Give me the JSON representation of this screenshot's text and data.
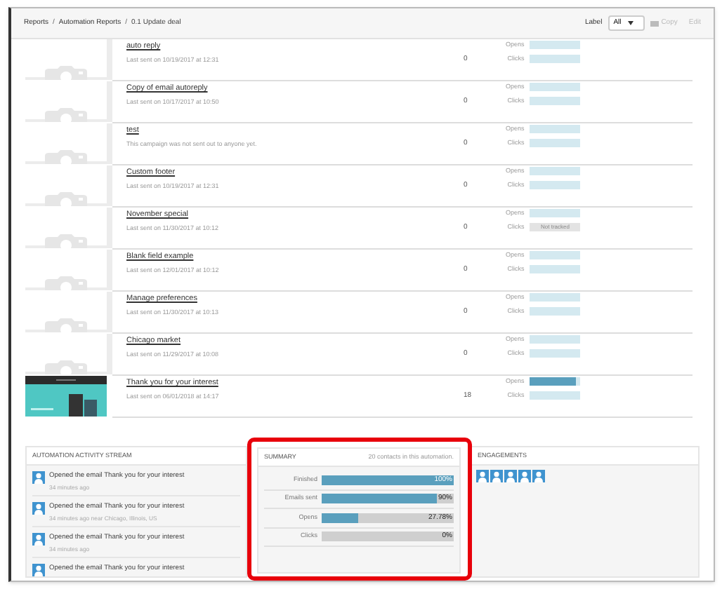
{
  "breadcrumb": [
    {
      "kind": "link",
      "text": "Reports"
    },
    {
      "kind": "separator",
      "text": "/"
    },
    {
      "kind": "link",
      "text": "Automation Reports"
    },
    {
      "kind": "separator",
      "text": "/"
    },
    {
      "kind": "current",
      "text": "0.1 Update deal"
    }
  ],
  "toolbar": {
    "label": "Label",
    "select_value": "All",
    "copy": "Copy",
    "edit": "Edit"
  },
  "emails": [
    {
      "name": "auto reply",
      "meta": "Last sent on 10/19/2017 at 12:31",
      "count": "0",
      "kind": "placeholder",
      "opens": {
        "label": "Opens",
        "level": 0
      },
      "clicks": {
        "label": "Clicks",
        "level": 0
      }
    },
    {
      "name": "Copy of email autoreply",
      "meta": "Last sent on 10/17/2017 at 10:50",
      "count": "0",
      "kind": "placeholder",
      "opens": {
        "label": "Opens",
        "level": 0
      },
      "clicks": {
        "label": "Clicks",
        "level": 0
      }
    },
    {
      "name": "test",
      "meta": "This campaign was not sent out to anyone yet.",
      "count": "0",
      "kind": "placeholder",
      "opens": {
        "label": "Opens",
        "level": 0
      },
      "clicks": {
        "label": "Clicks",
        "level": 0
      }
    },
    {
      "name": "Custom footer",
      "meta": "Last sent on 10/19/2017 at 12:31",
      "count": "0",
      "kind": "placeholder",
      "opens": {
        "label": "Opens",
        "level": 0
      },
      "clicks": {
        "label": "Clicks",
        "level": 0
      }
    },
    {
      "name": "November special",
      "meta": "Last sent on 11/30/2017 at 10:12",
      "count": "0",
      "kind": "placeholder",
      "opens": {
        "label": "Opens",
        "level": 0
      },
      "clicks": {
        "label": "Clicks",
        "note": "Not tracked"
      }
    },
    {
      "name": "Blank field example",
      "meta": "Last sent on 12/01/2017 at 10:12",
      "count": "0",
      "kind": "placeholder",
      "opens": {
        "label": "Opens",
        "level": 0
      },
      "clicks": {
        "label": "Clicks",
        "level": 0
      }
    },
    {
      "name": "Manage preferences",
      "meta": "Last sent on 11/30/2017 at 10:13",
      "count": "0",
      "kind": "placeholder",
      "opens": {
        "label": "Opens",
        "level": 0
      },
      "clicks": {
        "label": "Clicks",
        "level": 0
      }
    },
    {
      "name": "Chicago market",
      "meta": "Last sent on 11/29/2017 at 10:08",
      "count": "0",
      "kind": "placeholder",
      "opens": {
        "label": "Opens",
        "level": 0
      },
      "clicks": {
        "label": "Clicks",
        "level": 0
      }
    },
    {
      "name": "Thank you for your interest",
      "meta": "Last sent on 06/01/2018 at 14:17",
      "count": "18",
      "kind": "picture",
      "opens": {
        "label": "Opens",
        "level": 0.92
      },
      "clicks": {
        "label": "Clicks",
        "level": 0
      }
    }
  ],
  "activity_stream": {
    "title": "AUTOMATION ACTIVITY STREAM",
    "items": [
      {
        "text": "Opened the email Thank you for your interest",
        "time": "34 minutes ago"
      },
      {
        "text": "Opened the email Thank you for your interest",
        "time": "34 minutes ago near Chicago, Illinois, US"
      },
      {
        "text": "Opened the email Thank you for your interest",
        "time": "34 minutes ago"
      },
      {
        "text": "Opened the email Thank you for your interest"
      }
    ]
  },
  "summary": {
    "title": "SUMMARY",
    "subtitle": "20 contacts in this automation.",
    "highlighted": true,
    "bars": [
      {
        "label": "Finished",
        "level": 1,
        "reading": "100%"
      },
      {
        "label": "Emails sent",
        "level": 0.9,
        "reading": "90%"
      },
      {
        "label": "Opens",
        "level": 0.2778,
        "reading": "27.78%"
      },
      {
        "label": "Clicks",
        "level": 0,
        "reading": "0%"
      }
    ]
  },
  "engagements": {
    "title": "ENGAGEMENTS",
    "contacts": [
      {
        "kind": "avatar"
      },
      {
        "kind": "avatar"
      },
      {
        "kind": "avatar"
      },
      {
        "kind": "avatar"
      },
      {
        "kind": "avatar"
      }
    ]
  }
}
